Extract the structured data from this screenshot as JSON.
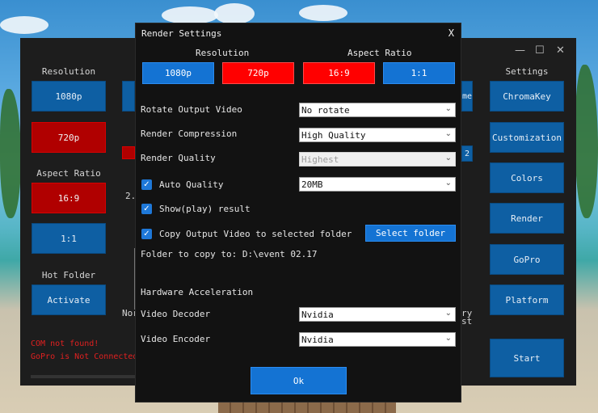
{
  "main_window": {
    "left_panel": {
      "resolution_label": "Resolution",
      "btn_1080p": "1080p",
      "btn_720p": "720p",
      "aspect_ratio_label": "Aspect Ratio",
      "btn_16_9": "16:9",
      "btn_1_1": "1:1",
      "hot_folder_label": "Hot Folder",
      "activate_label": "Activate",
      "errors": [
        "COM not found!",
        "GoPro is Not Connected"
      ]
    },
    "right_panel": {
      "settings_label": "Settings",
      "buttons": [
        "ChromaKey",
        "Customization",
        "Colors",
        "Render",
        "GoPro",
        "Platform"
      ],
      "start_label": "Start"
    },
    "partial_text": {
      "mid_left_1": "Nor",
      "mid_right_1": "ry",
      "mid_right_2": "st",
      "mid_right_3": "me",
      "mid_right_4": "2",
      "mid_left_2": "2."
    }
  },
  "dialog": {
    "title": "Render Settings",
    "close": "X",
    "resolution_header": "Resolution",
    "aspect_header": "Aspect Ratio",
    "res_1080p": "1080p",
    "res_720p": "720p",
    "ar_16_9": "16:9",
    "ar_1_1": "1:1",
    "rotate_label": "Rotate Output Video",
    "rotate_value": "No rotate",
    "compression_label": "Render Compression",
    "compression_value": "High Quality",
    "quality_label": "Render Quality",
    "quality_value": "Highest",
    "auto_quality_label": "Auto Quality",
    "auto_quality_value": "20MB",
    "show_result_label": "Show(play) result",
    "copy_output_label": "Copy Output Video to selected folder",
    "select_folder_label": "Select folder",
    "folder_text": "Folder to copy to: D:\\event 02.17",
    "hw_accel_label": "Hardware Acceleration",
    "decoder_label": "Video Decoder",
    "decoder_value": "Nvidia",
    "encoder_label": "Video Encoder",
    "encoder_value": "Nvidia",
    "ok_label": "Ok",
    "checkmark": "✓",
    "chevron": "⌄"
  },
  "colors": {
    "accent_blue": "#1473d3",
    "selected_red": "#ff0000",
    "dark_bg": "#121212",
    "error_red": "#e02020"
  }
}
